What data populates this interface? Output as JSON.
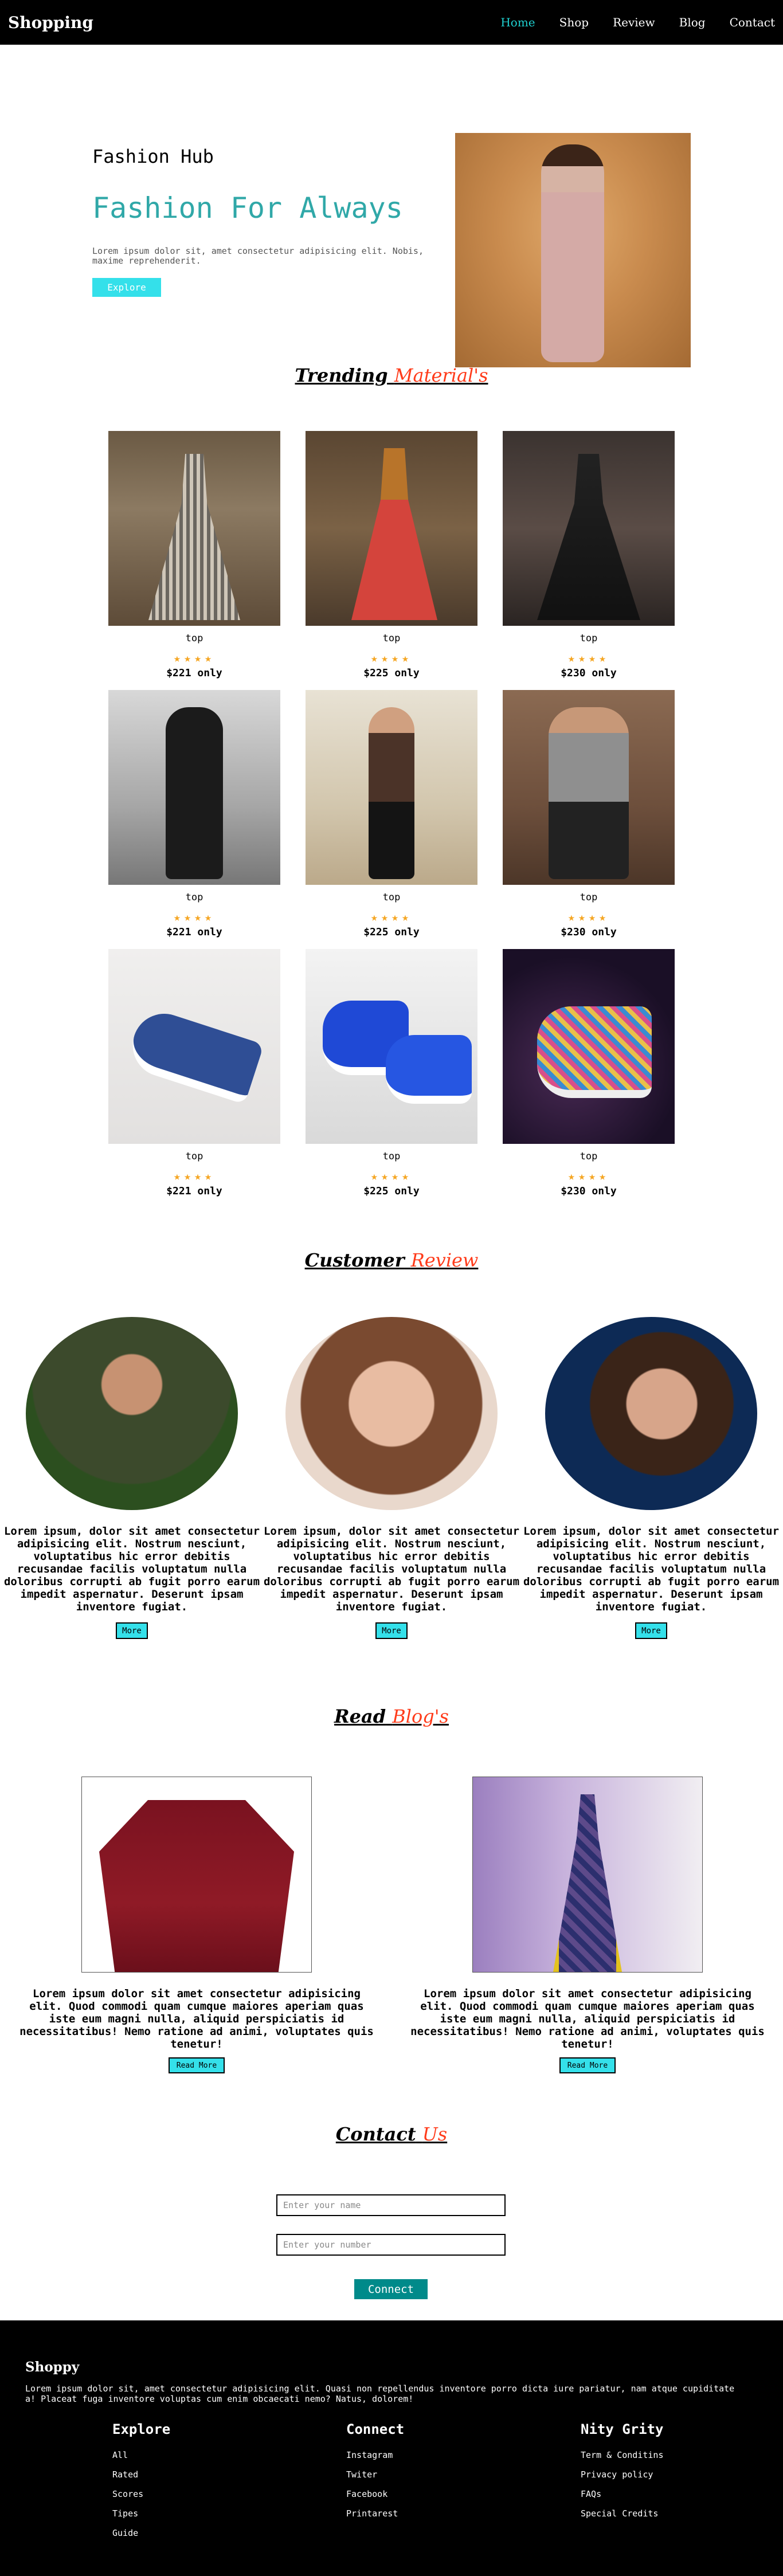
{
  "nav": {
    "logo": "Shopping",
    "items": [
      {
        "label": "Home",
        "active": true
      },
      {
        "label": "Shop",
        "active": false
      },
      {
        "label": "Review",
        "active": false
      },
      {
        "label": "Blog",
        "active": false
      },
      {
        "label": "Contact",
        "active": false
      }
    ]
  },
  "hero": {
    "subtitle": "Fashion Hub",
    "title": "Fashion For Always",
    "text": "Lorem ipsum dolor sit, amet consectetur adipisicing elit. Nobis, maxime reprehenderit.",
    "button": "Explore",
    "image": "fashion-model-photo"
  },
  "trending": {
    "title_plain": "Trending",
    "title_accent": "Material's",
    "products": [
      {
        "name": "top",
        "stars": "★★★★",
        "price": "$221 only",
        "image": "anarkali-dress-photo"
      },
      {
        "name": "top",
        "stars": "★★★★",
        "price": "$225 only",
        "image": "red-lehenga-photo"
      },
      {
        "name": "top",
        "stars": "★★★★",
        "price": "$230 only",
        "image": "black-gown-photo"
      },
      {
        "name": "top",
        "stars": "★★★★",
        "price": "$221 only",
        "image": "mens-black-outfit-photo"
      },
      {
        "name": "top",
        "stars": "★★★★",
        "price": "$225 only",
        "image": "mens-brown-suit-photo"
      },
      {
        "name": "top",
        "stars": "★★★★",
        "price": "$230 only",
        "image": "mens-grey-blazer-photo"
      },
      {
        "name": "top",
        "stars": "★★★★",
        "price": "$221 only",
        "image": "blue-sneaker-photo"
      },
      {
        "name": "top",
        "stars": "★★★★",
        "price": "$225 only",
        "image": "blue-orange-sneaker-photo"
      },
      {
        "name": "top",
        "stars": "★★★★",
        "price": "$230 only",
        "image": "glitter-sneaker-photo"
      }
    ]
  },
  "reviews": {
    "title_plain": "Customer",
    "title_accent": "Review",
    "items": [
      {
        "text": "Lorem ipsum, dolor sit amet consectetur adipisicing elit. Nostrum nesciunt, voluptatibus hic error debitis recusandae facilis voluptatum nulla doloribus corrupti ab fugit porro earum impedit aspernatur. Deserunt ipsam inventore fugiat.",
        "button": "More",
        "image": "customer-man-photo"
      },
      {
        "text": "Lorem ipsum, dolor sit amet consectetur adipisicing elit. Nostrum nesciunt, voluptatibus hic error debitis recusandae facilis voluptatum nulla doloribus corrupti ab fugit porro earum impedit aspernatur. Deserunt ipsam inventore fugiat.",
        "button": "More",
        "image": "customer-woman-photo"
      },
      {
        "text": "Lorem ipsum, dolor sit amet consectetur adipisicing elit. Nostrum nesciunt, voluptatibus hic error debitis recusandae facilis voluptatum nulla doloribus corrupti ab fugit porro earum impedit aspernatur. Deserunt ipsam inventore fugiat.",
        "button": "More",
        "image": "customer-woman-night-photo"
      }
    ]
  },
  "blog": {
    "title_plain": "Read",
    "title_accent": "Blog's",
    "items": [
      {
        "text": "Lorem ipsum dolor sit amet consectetur adipisicing elit. Quod commodi quam cumque maiores aperiam quas iste eum magni nulla, aliquid perspiciatis id necessitatibus! Nemo ratione ad animi, voluptates quis tenetur!",
        "button": "Read More",
        "image": "red-shirt-photo"
      },
      {
        "text": "Lorem ipsum dolor sit amet consectetur adipisicing elit. Quod commodi quam cumque maiores aperiam quas iste eum magni nulla, aliquid perspiciatis id necessitatibus! Nemo ratione ad animi, voluptates quis tenetur!",
        "button": "Read More",
        "image": "saree-photo"
      }
    ]
  },
  "contact": {
    "title_plain": "Contact",
    "title_accent": "Us",
    "name_placeholder": "Enter your name",
    "number_placeholder": "Enter your number",
    "button": "Connect"
  },
  "footer": {
    "title": "Shoppy",
    "text": "Lorem ipsum dolor sit, amet consectetur adipisicing elit. Quasi non repellendus inventore porro dicta iure pariatur, nam atque cupiditate a! Placeat fuga inventore voluptas cum enim obcaecati nemo? Natus, dolorem!",
    "columns": [
      {
        "heading": "Explore",
        "links": [
          "All",
          "Rated",
          "Scores",
          "Tipes",
          "Guide"
        ]
      },
      {
        "heading": "Connect",
        "links": [
          "Instagram",
          "Twiter",
          "Facebook",
          "Printarest"
        ]
      },
      {
        "heading": "Nity Grity",
        "links": [
          "Term & Conditins",
          "Privacy policy",
          "FAQs",
          "Special Credits"
        ]
      }
    ]
  },
  "colors": {
    "accent": "#1fd1d1",
    "button": "#34e0ea",
    "connect": "#008a8a",
    "heading_accent": "#ff3b1a",
    "hero_title": "#30a8a8"
  }
}
